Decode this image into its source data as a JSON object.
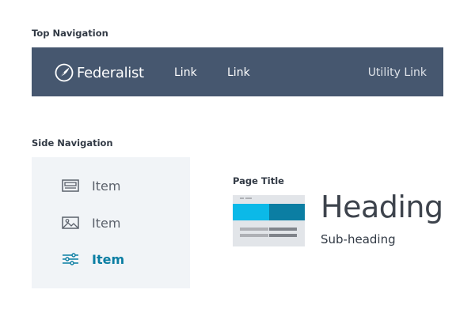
{
  "sections": {
    "top_nav_label": "Top Navigation",
    "side_nav_label": "Side Navigation",
    "page_title_label": "Page Title"
  },
  "top_nav": {
    "brand": "Federalist",
    "links": [
      "Link",
      "Link"
    ],
    "utility_link": "Utility Link",
    "background": "#46576f"
  },
  "side_nav": {
    "items": [
      {
        "label": "Item",
        "icon": "browser-window-icon",
        "active": false
      },
      {
        "label": "Item",
        "icon": "image-icon",
        "active": false
      },
      {
        "label": "Item",
        "icon": "sliders-icon",
        "active": true
      }
    ],
    "active_color": "#0b7ea3",
    "background": "#f1f4f7"
  },
  "page_title": {
    "heading": "Heading",
    "subheading": "Sub-heading",
    "thumbnail_icon": "page-layout-thumbnail",
    "accent_colors": [
      "#0bb9e8",
      "#0b7ea3"
    ]
  }
}
